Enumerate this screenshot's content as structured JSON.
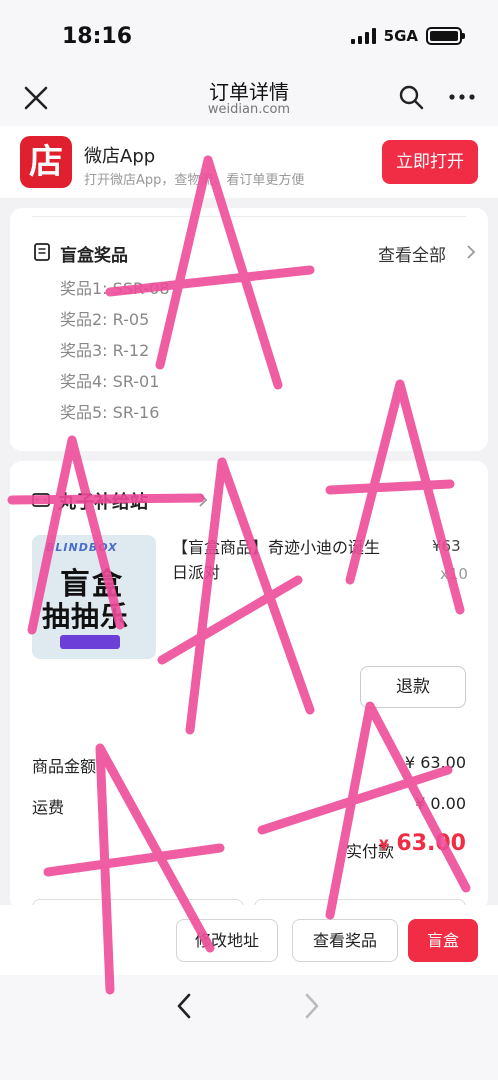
{
  "status": {
    "time": "18:16",
    "network": "5GA"
  },
  "nav": {
    "title": "订单详情",
    "subtitle": "weidian.com"
  },
  "app_banner": {
    "logo_char": "店",
    "name": "微店App",
    "description": "打开微店App，查物流、看订单更方便",
    "open_label": "立即打开"
  },
  "prizes": {
    "title": "盲盒奖品",
    "view_all": "查看全部",
    "items": [
      "奖品1: SSR-08",
      "奖品2: R-05",
      "奖品3: R-12",
      "奖品4: SR-01",
      "奖品5: SR-16"
    ]
  },
  "shop": {
    "name": "丸子补给站",
    "product": {
      "title": "【盲盒商品】奇迹小迪の诞生日派对",
      "price": "¥63",
      "quantity": "x10",
      "image_brand": "BLINDBOX",
      "image_line1": "盲盒",
      "image_line2": "抽抽乐"
    },
    "refund_label": "退款",
    "goods_amount_label": "商品金额",
    "goods_amount_value": "¥ 63.00",
    "shipping_label": "运费",
    "shipping_value": "¥ 0.00",
    "paid_label": "实付款",
    "paid_currency": "¥",
    "paid_value": "63.00"
  },
  "actions": {
    "modify_address": "修改地址",
    "view_prizes": "查看奖品",
    "blindbox": "盲盒"
  },
  "colors": {
    "accent": "#f02d45",
    "logo": "#e0202e",
    "scribble": "#ee4c9a"
  },
  "icons": [
    "close-icon",
    "search-icon",
    "more-icon",
    "document-icon",
    "shop-icon",
    "chevron-right-icon",
    "back-arrow-icon",
    "forward-arrow-icon"
  ]
}
